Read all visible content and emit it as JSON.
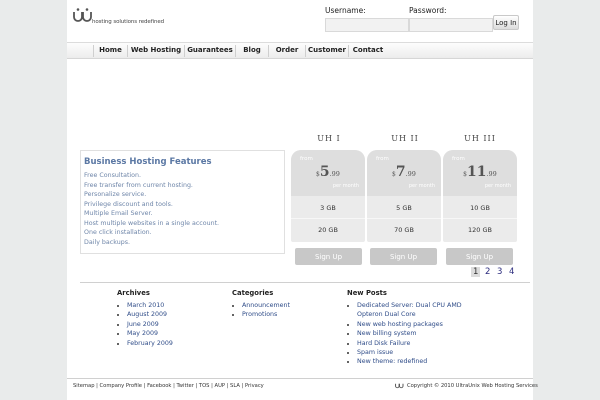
{
  "header": {
    "logo_text": "hosting solutions redefined",
    "username_label": "Username:",
    "password_label": "Password:",
    "username_value": "",
    "password_value": "",
    "login_button": "Log In"
  },
  "nav": [
    {
      "label": "Home"
    },
    {
      "label": "Web Hosting"
    },
    {
      "label": "Guarantees"
    },
    {
      "label": "Blog"
    },
    {
      "label": "Order"
    },
    {
      "label": "Customer"
    },
    {
      "label": "Contact"
    }
  ],
  "features": {
    "title": "Business Hosting Features",
    "items": [
      "Free Consultation.",
      "Free transfer from current hosting.",
      "Personalize service.",
      "Privilege discount and tools.",
      "Multiple Email Server.",
      "Host multiple websites in a single account.",
      "One click installation.",
      "Daily backups."
    ]
  },
  "plans": [
    {
      "name": "UH I",
      "from": "from",
      "currency": "$",
      "price_whole": "5",
      "price_cents": ".99",
      "per": "per month",
      "storage": "3 GB",
      "bandwidth": "20 GB",
      "signup": "Sign Up"
    },
    {
      "name": "UH II",
      "from": "from",
      "currency": "$",
      "price_whole": "7",
      "price_cents": ".99",
      "per": "per month",
      "storage": "5 GB",
      "bandwidth": "70 GB",
      "signup": "Sign Up"
    },
    {
      "name": "UH III",
      "from": "from",
      "currency": "$",
      "price_whole": "11",
      "price_cents": ".99",
      "per": "per month",
      "storage": "10 GB",
      "bandwidth": "120 GB",
      "signup": "Sign Up"
    }
  ],
  "pagination": {
    "pages": [
      "1",
      "2",
      "3",
      "4"
    ],
    "current": "1"
  },
  "archives": {
    "title": "Archives",
    "items": [
      "March 2010",
      "August 2009",
      "June 2009",
      "May 2009",
      "February 2009"
    ]
  },
  "categories": {
    "title": "Categories",
    "items": [
      "Announcement",
      "Promotions"
    ]
  },
  "new_posts": {
    "title": "New Posts",
    "items": [
      "Dedicated Server: Dual CPU AMD",
      "Opteron Dual Core",
      "New web hosting packages",
      "New billing system",
      "Hard Disk Failure",
      "Spam issue",
      "New theme: redefined"
    ]
  },
  "footer": {
    "links": [
      "Sitemap",
      "Company Profile",
      "Facebook",
      "Twitter",
      "TOS",
      "AUP",
      "SLA",
      "Privacy"
    ],
    "separator": " | ",
    "copyright": "Copyright © 2010 UltraUnix Web Hosting Services"
  },
  "colors": {
    "page_background": "#e9ebeb",
    "link_blue": "#2f4c88",
    "feature_title": "#5b78a4",
    "plan_gray": "#dedede"
  }
}
